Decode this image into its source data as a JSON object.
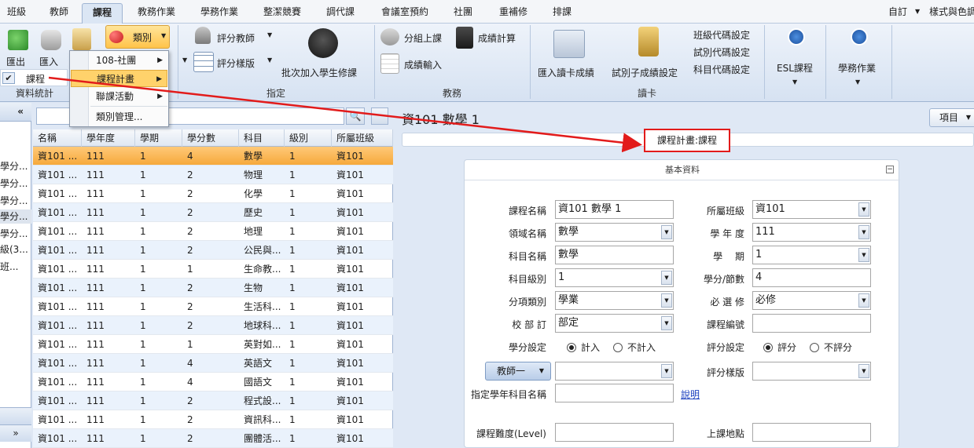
{
  "menu": {
    "tabs": [
      "班級",
      "教師",
      "課程",
      "教務作業",
      "學務作業",
      "整潔競賽",
      "調代課",
      "會議室預約",
      "社團",
      "重補修",
      "排課"
    ],
    "active": "課程",
    "right": {
      "custom": "自訂",
      "style": "樣式與色調"
    }
  },
  "ribbon": {
    "export_label": "匯出",
    "import_label": "匯入",
    "category_label": "類別",
    "data_stats_label": "資料統計",
    "assign_teacher": "評分教師",
    "grade_template": "評分樣版",
    "batch_join": "批次加入學生修課",
    "assign_group": "指定",
    "group_class": "分組上課",
    "score_calc": "成績計算",
    "score_input": "成績輸入",
    "academic_group": "教務",
    "import_card": "匯入讀卡成績",
    "exam_code": "試別子成績設定",
    "class_code": "班級代碼設定",
    "exam_code_set": "試別代碼設定",
    "subject_code": "科目代碼設定",
    "card_group": "讀卡",
    "esl": "ESL課程",
    "student_affairs": "學務作業"
  },
  "dropdown": {
    "items": [
      "108-社團",
      "課程計畫",
      "聯課活動",
      "類別管理..."
    ]
  },
  "checked_item": "課程",
  "leftpane": {
    "toggle": "«",
    "items": [
      "學分...",
      "學分...",
      "學分...",
      "學分...",
      "學分...",
      "級(3...",
      "班..."
    ],
    "bottom_toggle": "»"
  },
  "grid": {
    "columns": [
      "名稱",
      "學年度",
      "學期",
      "學分數",
      "科目",
      "級別",
      "所屬班級"
    ],
    "rows": [
      [
        "資101 ...",
        "111",
        "1",
        "4",
        "數學",
        "1",
        "資101"
      ],
      [
        "資101 ...",
        "111",
        "1",
        "2",
        "物理",
        "1",
        "資101"
      ],
      [
        "資101 ...",
        "111",
        "1",
        "2",
        "化學",
        "1",
        "資101"
      ],
      [
        "資101 ...",
        "111",
        "1",
        "2",
        "歷史",
        "1",
        "資101"
      ],
      [
        "資101 ...",
        "111",
        "1",
        "2",
        "地理",
        "1",
        "資101"
      ],
      [
        "資101 ...",
        "111",
        "1",
        "2",
        "公民與...",
        "1",
        "資101"
      ],
      [
        "資101 ...",
        "111",
        "1",
        "1",
        "生命教...",
        "1",
        "資101"
      ],
      [
        "資101 ...",
        "111",
        "1",
        "2",
        "生物",
        "1",
        "資101"
      ],
      [
        "資101 ...",
        "111",
        "1",
        "2",
        "生活科...",
        "1",
        "資101"
      ],
      [
        "資101 ...",
        "111",
        "1",
        "2",
        "地球科...",
        "1",
        "資101"
      ],
      [
        "資101 ...",
        "111",
        "1",
        "1",
        "英對如...",
        "1",
        "資101"
      ],
      [
        "資101 ...",
        "111",
        "1",
        "4",
        "英語文",
        "1",
        "資101"
      ],
      [
        "資101 ...",
        "111",
        "1",
        "4",
        "國語文",
        "1",
        "資101"
      ],
      [
        "資101 ...",
        "111",
        "1",
        "2",
        "程式設...",
        "1",
        "資101"
      ],
      [
        "資101 ...",
        "111",
        "1",
        "2",
        "資訊科...",
        "1",
        "資101"
      ],
      [
        "資101 ...",
        "111",
        "1",
        "2",
        "團體活...",
        "1",
        "資101"
      ]
    ]
  },
  "detail": {
    "title": "資101 數學 1",
    "items_button": "項目",
    "crumb": "課程計畫:課程",
    "card_title": "基本資料",
    "labels": {
      "course_name": "課程名稱",
      "domain": "領域名稱",
      "subject": "科目名稱",
      "subject_level": "科目級別",
      "category": "分項類別",
      "required_by": "校 部 訂",
      "credit_setting": "學分設定",
      "class": "所屬班級",
      "school_year": "學 年 度",
      "semester": "學　 期",
      "credits": "學分/節數",
      "required": "必 選 修",
      "course_code": "課程編號",
      "grade_setting": "評分設定",
      "grade_template": "評分樣版",
      "year_subject_name": "指定學年科目名稱",
      "difficulty": "課程難度(Level)",
      "location": "上課地點"
    },
    "values": {
      "course_name": "資101 數學 1",
      "domain": "數學",
      "subject": "數學",
      "subject_level": "1",
      "category": "學業",
      "required_by": "部定",
      "class": "資101",
      "school_year": "111",
      "semester": "1",
      "credits": "4",
      "required": "必修",
      "course_code": "",
      "teacher": "",
      "grade_template": "",
      "year_subject_name": "",
      "difficulty": "",
      "location": ""
    },
    "radio": {
      "count": "計入",
      "no_count": "不計入",
      "grade": "評分",
      "no_grade": "不評分"
    },
    "teacher_button": "教師一",
    "explain_link": "說明"
  },
  "colors": {
    "accent": "#f6a93b",
    "annotation": "#e21b1b"
  }
}
